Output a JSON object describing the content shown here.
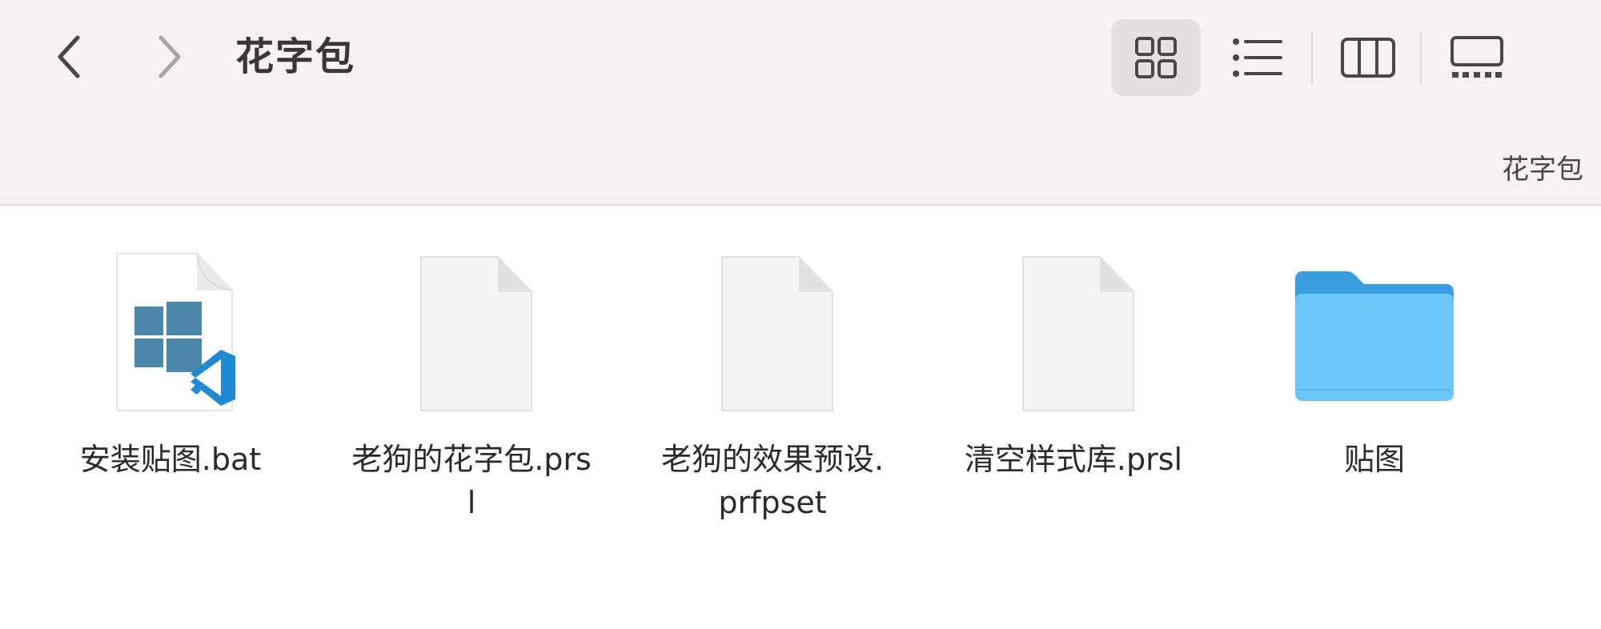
{
  "window": {
    "title": "花字包",
    "path_label": "花字包"
  },
  "nav": {
    "back_icon": "chevron-left-icon",
    "forward_icon": "chevron-right-icon"
  },
  "view_modes": [
    {
      "name": "icon-view",
      "icon": "grid-icon",
      "active": true
    },
    {
      "name": "list-view",
      "icon": "list-icon",
      "active": false
    },
    {
      "name": "column-view",
      "icon": "columns-icon",
      "active": false
    },
    {
      "name": "gallery-view",
      "icon": "gallery-icon",
      "active": false
    }
  ],
  "files": [
    {
      "name": "安装贴图.bat",
      "type": "bat",
      "icon": "batch-file-icon"
    },
    {
      "name": "老狗的花字包.prsl",
      "type": "document",
      "icon": "document-icon"
    },
    {
      "name": "老狗的效果预设.prfpset",
      "type": "document",
      "icon": "document-icon"
    },
    {
      "name": "清空样式库.prsl",
      "type": "document",
      "icon": "document-icon"
    },
    {
      "name": "贴图",
      "type": "folder",
      "icon": "folder-icon"
    }
  ],
  "colors": {
    "toolbar_bg": "#f6f2ef",
    "folder_blue": "#6cc6f7",
    "windows_blue": "#4a87a8",
    "vscode_blue": "#1f8ad2"
  }
}
